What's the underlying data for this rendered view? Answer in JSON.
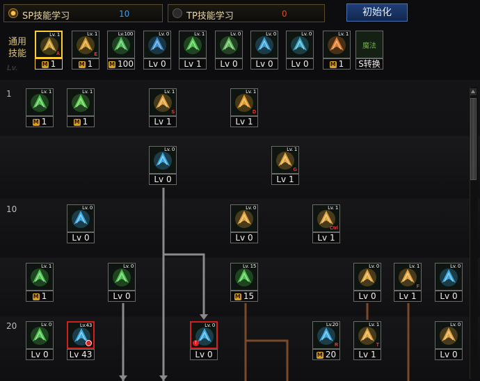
{
  "tabs": {
    "sp": {
      "label": "SP技能学习",
      "value": "10"
    },
    "tp": {
      "label": "TP技能学习",
      "value": "0"
    }
  },
  "reset_button": "初始化",
  "common_skills_label": "通用技能",
  "row_labels": [
    "1",
    "10",
    "20"
  ],
  "icon_icons": {
    "dash": "dash-skill-icon",
    "flame": "flame-skill-icon",
    "beam": "beam-skill-icon",
    "wings": "wings-skill-icon",
    "target": "target-skill-icon",
    "figure": "figure-skill-icon",
    "orb": "orb-skill-icon",
    "armor": "armor-skill-icon",
    "swap": "swap-skill-icon"
  },
  "common_skills": [
    {
      "lv_tag": "Lv. 1",
      "key": "A",
      "level": "1",
      "mastered": true,
      "selected": true,
      "icon": "dash-skill-icon",
      "color": "#c99a2e"
    },
    {
      "lv_tag": "Lv. 1",
      "key": "E",
      "level": "1",
      "mastered": true,
      "icon": "kick-skill-icon",
      "color": "#d49a28"
    },
    {
      "lv_tag": "Lv.100",
      "key": "",
      "level": "100",
      "mastered": true,
      "icon": "beam-skill-icon",
      "color": "#4dbb55"
    },
    {
      "lv_tag": "Lv. 0",
      "key": "",
      "level": "Lv 0",
      "mastered": false,
      "icon": "wings-skill-icon",
      "color": "#3a8fd0"
    },
    {
      "lv_tag": "Lv. 1",
      "key": "",
      "level": "Lv 1",
      "mastered": false,
      "icon": "target-skill-icon",
      "color": "#4cc24c"
    },
    {
      "lv_tag": "Lv. 0",
      "key": "",
      "level": "Lv 0",
      "mastered": false,
      "icon": "figure-skill-icon",
      "color": "#5fb85a"
    },
    {
      "lv_tag": "Lv. 0",
      "key": "",
      "level": "Lv 0",
      "mastered": false,
      "icon": "orb-skill-icon",
      "color": "#3aa0d8"
    },
    {
      "lv_tag": "Lv. 0",
      "key": "",
      "level": "Lv 0",
      "mastered": false,
      "icon": "armor-skill-icon",
      "color": "#3aa7c8"
    },
    {
      "lv_tag": "Lv. 1",
      "key": "",
      "level": "1",
      "mastered": true,
      "icon": "explosion-skill-icon",
      "color": "#e0792a"
    },
    {
      "lv_tag": "",
      "key": "",
      "level": "S转换",
      "mastered": false,
      "icon": "swap-skill-icon",
      "icon_text": "魔法",
      "color": "#6fae4e"
    }
  ],
  "tree_skills": [
    {
      "id": "r1a",
      "lv_tag": "Lv. 1",
      "key": "",
      "level": "1",
      "mastered": true,
      "icon": "cross-skill-icon",
      "color": "#4cc24c"
    },
    {
      "id": "r1b",
      "lv_tag": "Lv. 1",
      "key": "",
      "level": "1",
      "mastered": true,
      "icon": "cross-skill-icon",
      "color": "#5ac94a"
    },
    {
      "id": "r1c",
      "lv_tag": "Lv. 1",
      "key": "S",
      "level": "Lv 1",
      "mastered": false,
      "icon": "strike-skill-icon",
      "color": "#e0a23a"
    },
    {
      "id": "r1d",
      "lv_tag": "Lv. 1",
      "key": "D",
      "level": "Lv 1",
      "mastered": false,
      "icon": "slash-skill-icon",
      "color": "#e29a25"
    },
    {
      "id": "r2a",
      "lv_tag": "Lv. 0",
      "key": "",
      "level": "Lv 0",
      "mastered": false,
      "icon": "wave-skill-icon",
      "color": "#3aa8e0"
    },
    {
      "id": "r2b",
      "lv_tag": "Lv. 1",
      "key": "G",
      "level": "Lv 1",
      "mastered": false,
      "icon": "burst-skill-icon",
      "color": "#e0a23a"
    },
    {
      "id": "r3a",
      "lv_tag": "Lv. 0",
      "key": "",
      "level": "Lv 0",
      "mastered": false,
      "icon": "cross-blue-skill-icon",
      "color": "#3aa8e0"
    },
    {
      "id": "r3b",
      "lv_tag": "Lv. 0",
      "key": "",
      "level": "Lv 0",
      "mastered": false,
      "icon": "claw-skill-icon",
      "color": "#e0a23a"
    },
    {
      "id": "r3c",
      "lv_tag": "Lv. 1",
      "key": "Ctrl",
      "level": "Lv 1",
      "mastered": false,
      "icon": "fist-skill-icon",
      "color": "#e0a23a"
    },
    {
      "id": "r4a",
      "lv_tag": "Lv. 1",
      "key": "",
      "level": "1",
      "mastered": true,
      "icon": "leaf-skill-icon",
      "color": "#4cc24c"
    },
    {
      "id": "r4b",
      "lv_tag": "Lv. 0",
      "key": "",
      "level": "Lv 0",
      "mastered": false,
      "icon": "shield-skill-icon",
      "color": "#4cc24c"
    },
    {
      "id": "r4c",
      "lv_tag": "Lv. 15",
      "key": "",
      "level": "15",
      "mastered": true,
      "icon": "swords-skill-icon",
      "color": "#4cc24c"
    },
    {
      "id": "r4d",
      "lv_tag": "Lv. 0",
      "key": "",
      "level": "Lv 0",
      "mastered": false,
      "icon": "pillar-skill-icon",
      "color": "#e0a23a"
    },
    {
      "id": "r4e",
      "lv_tag": "Lv. 1",
      "key": "F",
      "level": "Lv 1",
      "mastered": false,
      "icon": "jump-skill-icon",
      "color": "#e0a23a"
    },
    {
      "id": "r4f",
      "lv_tag": "Lv. 0",
      "key": "",
      "level": "Lv 0",
      "mastered": false,
      "icon": "mask-skill-icon",
      "color": "#3aa8e0"
    },
    {
      "id": "r5a",
      "lv_tag": "Lv. 0",
      "key": "",
      "level": "Lv 0",
      "mastered": false,
      "icon": "wind-skill-icon",
      "color": "#4cc24c"
    },
    {
      "id": "r5b",
      "lv_tag": "Lv.43",
      "key": "",
      "level": "Lv 43",
      "mastered": false,
      "red": true,
      "clock": true,
      "icon": "tornado-skill-icon",
      "color": "#3aa8e0"
    },
    {
      "id": "r5c",
      "lv_tag": "Lv. 0",
      "key": "",
      "level": "Lv 0",
      "mastered": false,
      "red": true,
      "warn": true,
      "icon": "note-skill-icon",
      "color": "#3aa8e0"
    },
    {
      "id": "r5d",
      "lv_tag": "Lv.20",
      "key": "R",
      "level": "20",
      "mastered": true,
      "icon": "shards-skill-icon",
      "color": "#3aa8e0"
    },
    {
      "id": "r5e",
      "lv_tag": "Lv. 1",
      "key": "T",
      "level": "Lv 1",
      "mastered": false,
      "icon": "spear-skill-icon",
      "color": "#e0a23a"
    },
    {
      "id": "r5f",
      "lv_tag": "Lv. 0",
      "key": "",
      "level": "Lv 0",
      "mastered": false,
      "icon": "ring-skill-icon",
      "color": "#e0a23a"
    }
  ],
  "colors": {
    "accent_gold": "#ffcc33",
    "sp_points": "#3d9df5",
    "tp_points": "#e04a2a",
    "connector_gray": "#8a8a8a",
    "connector_brown": "#7a4a28"
  }
}
